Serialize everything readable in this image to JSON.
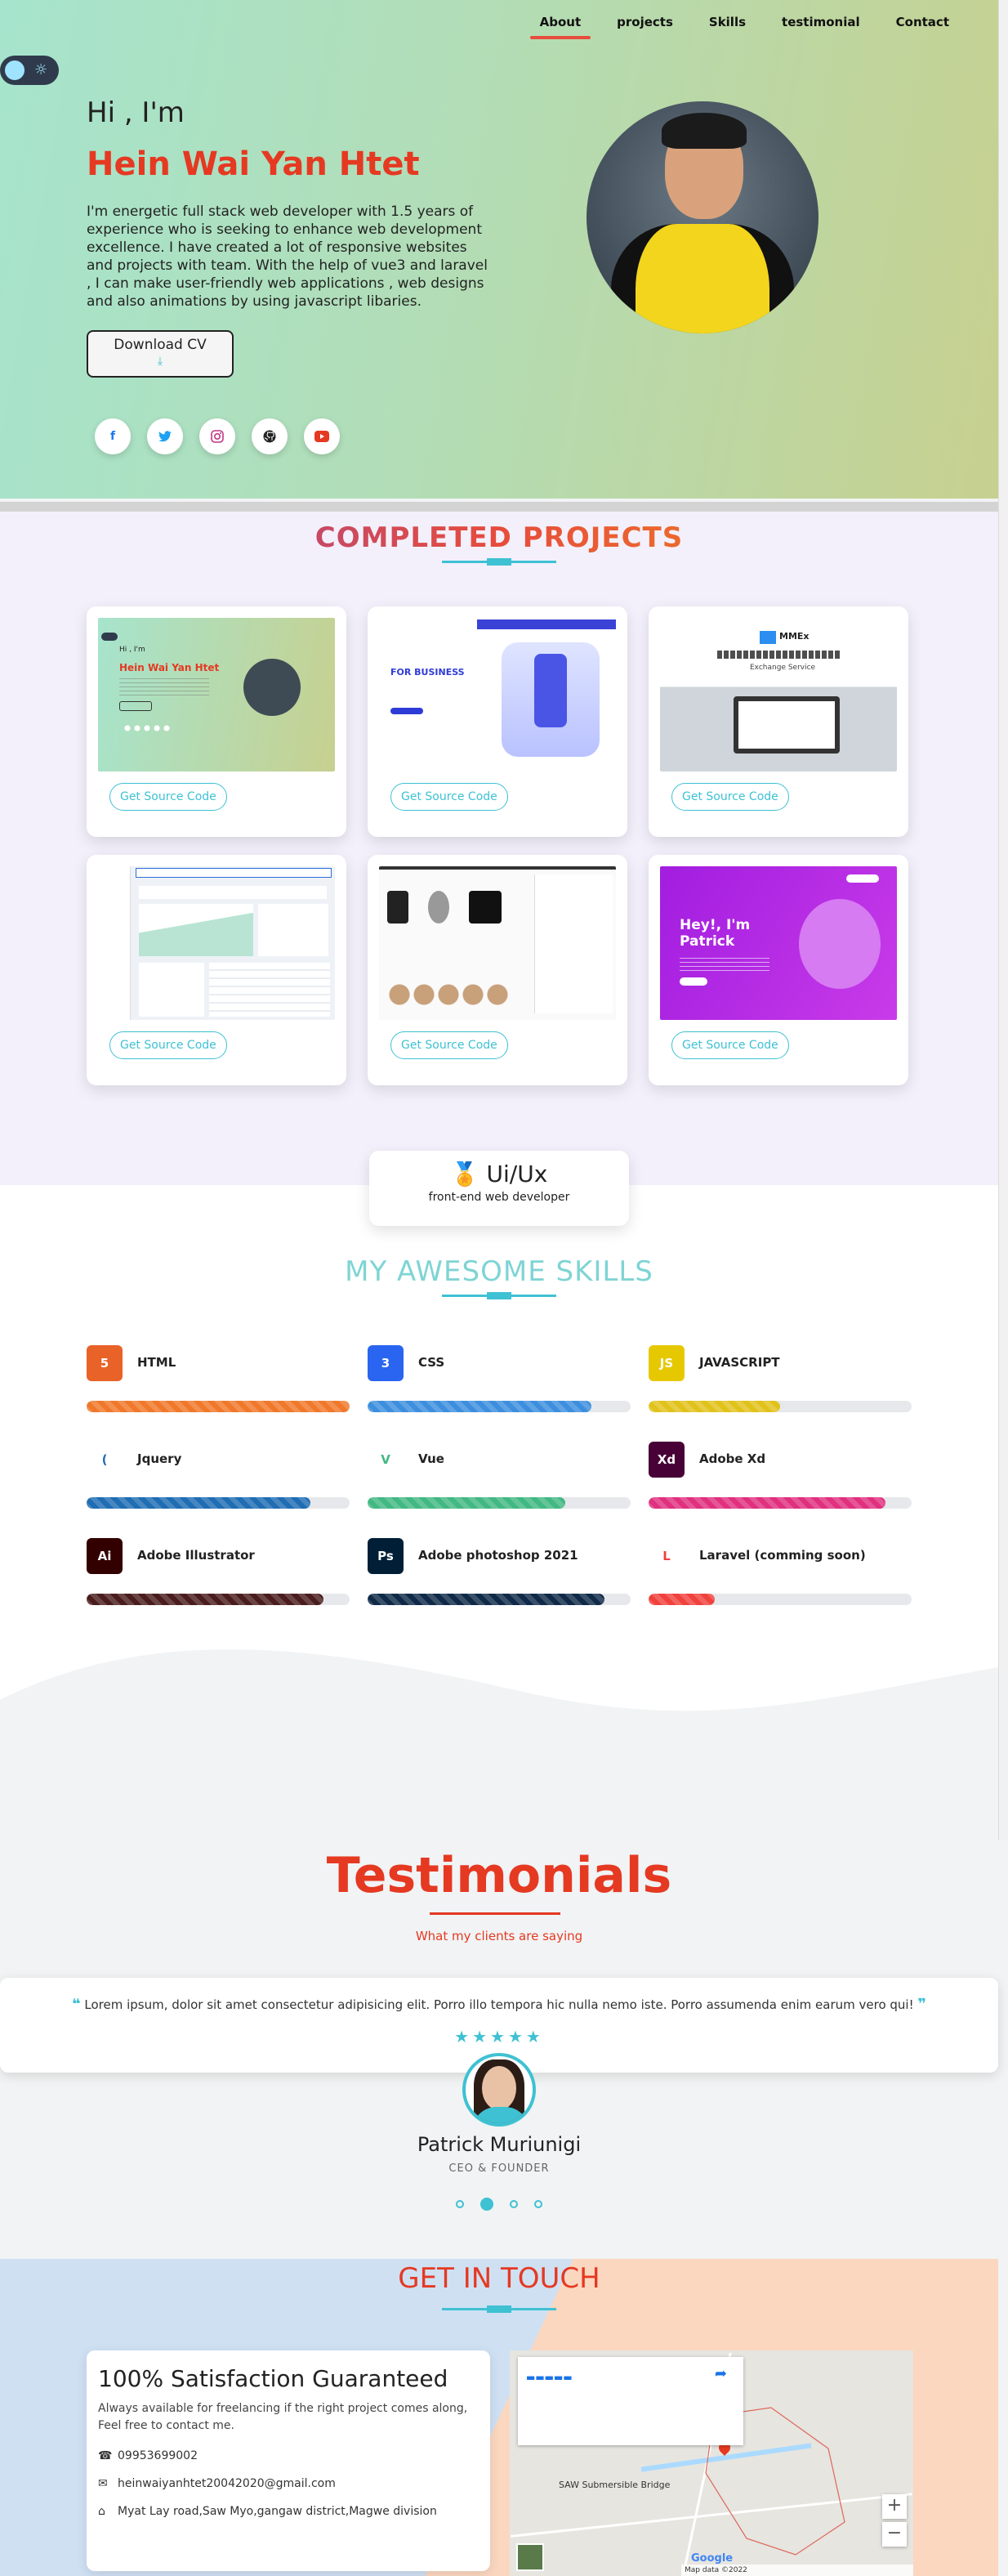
{
  "nav": {
    "items": [
      "About",
      "projects",
      "Skills",
      "testimonial",
      "Contact"
    ],
    "active_index": 0
  },
  "hero": {
    "greeting": "Hi , I'm",
    "name": "Hein Wai Yan Htet",
    "bio": "I'm energetic full stack web developer with 1.5 years of experience who is seeking to enhance web development excellence. I have created a lot of responsive websites and projects with team. With the help of vue3 and laravel , I can make user-friendly web applications , web designs and also animations by using javascript libaries.",
    "cv_button": "Download CV",
    "socials": [
      "facebook-icon",
      "twitter-icon",
      "instagram-icon",
      "github-icon",
      "youtube-icon"
    ]
  },
  "projects": {
    "title": "COMPLETED PROJECTS",
    "button_label": "Get Source Code",
    "thumb_texts": {
      "p1_hi": "Hi , I'm",
      "p1_name": "Hein Wai Yan Htet",
      "p2_title": "FOR BUSINESS",
      "p3_brand": "MMEx",
      "p3_sub": "Exchange Service",
      "p6_title": "Hey!, I'm Patrick"
    }
  },
  "badge": {
    "title": "Ui/Ux",
    "subtitle": "front-end web developer"
  },
  "skills": {
    "title": "MY AWESOME SKILLS",
    "items": [
      {
        "label": "HTML",
        "icon": "html5-icon",
        "level": 1.0,
        "color": "#f0782a",
        "icon_bg": "#e96228",
        "glyph": "5"
      },
      {
        "label": "CSS",
        "icon": "css3-icon",
        "level": 0.85,
        "color": "#3d8fde",
        "icon_bg": "#2965f1",
        "glyph": "3"
      },
      {
        "label": "JAVASCRIPT",
        "icon": "javascript-icon",
        "level": 0.5,
        "color": "#e0c21b",
        "icon_bg": "#e6c800",
        "glyph": "JS"
      },
      {
        "label": "Jquery",
        "icon": "jquery-icon",
        "level": 0.85,
        "color": "#1f6db3",
        "icon_bg": "#ffffff",
        "glyph": "("
      },
      {
        "label": "Vue",
        "icon": "vue-icon",
        "level": 0.75,
        "color": "#42b883",
        "icon_bg": "#ffffff",
        "glyph": "V"
      },
      {
        "label": "Adobe Xd",
        "icon": "adobe-xd-icon",
        "level": 0.9,
        "color": "#e0307f",
        "icon_bg": "#470137",
        "glyph": "Xd"
      },
      {
        "label": "Adobe Illustrator",
        "icon": "adobe-illustrator-icon",
        "level": 0.9,
        "color": "#4a1c1c",
        "icon_bg": "#330000",
        "glyph": "Ai"
      },
      {
        "label": "Adobe photoshop 2021",
        "icon": "adobe-photoshop-icon",
        "level": 0.9,
        "color": "#0f2a48",
        "icon_bg": "#001e36",
        "glyph": "Ps"
      },
      {
        "label": "Laravel (comming soon)",
        "icon": "laravel-icon",
        "level": 0.25,
        "color": "#f0413d",
        "icon_bg": "#ffffff",
        "glyph": "L"
      }
    ]
  },
  "testimonials": {
    "title": "Testimonials",
    "subtitle": "What my clients are saying",
    "quote": "Lorem ipsum, dolor sit amet consectetur adipisicing elit. Porro illo tempora hic nulla nemo iste. Porro assumenda enim earum vero qui!",
    "rating": 5,
    "name": "Patrick Muriunigi",
    "role": "CEO & FOUNDER",
    "slides": 4,
    "active_slide": 1
  },
  "contact": {
    "title": "GET IN TOUCH",
    "heading": "100% Satisfaction Guaranteed",
    "text": "Always available for freelancing if the right project comes along, Feel free to contact me.",
    "phone": "09953699002",
    "email": "heinwaiyanhtet20042020@gmail.com",
    "address": "Myat Lay road,Saw Myo,gangaw district,Magwe division"
  },
  "map": {
    "place_label": "SAW Submersible Bridge",
    "footer": "Map data ©2022",
    "logo": "Google"
  },
  "colors": {
    "accent": "#3ec1d3",
    "brand_red": "#e53922"
  }
}
